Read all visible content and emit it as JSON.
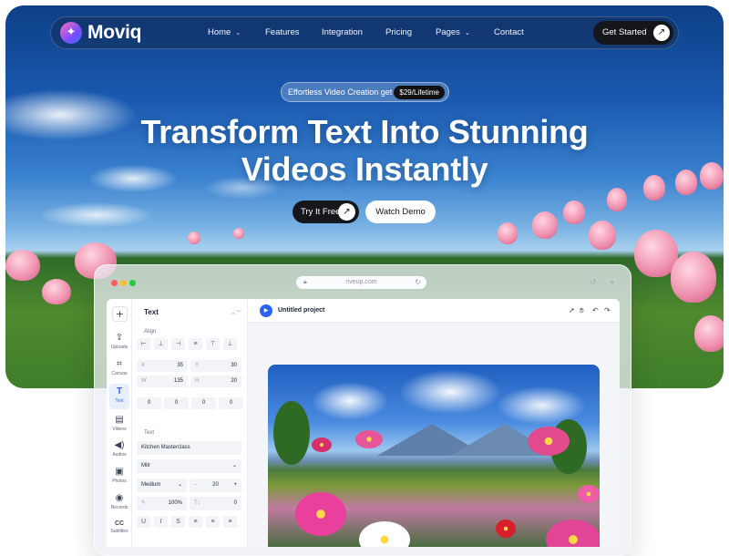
{
  "brand": {
    "name": "Moviq",
    "logo_icon": "sparkle-icon"
  },
  "nav": {
    "items": [
      {
        "label": "Home",
        "has_dropdown": true
      },
      {
        "label": "Features",
        "has_dropdown": false
      },
      {
        "label": "Integration",
        "has_dropdown": false
      },
      {
        "label": "Pricing",
        "has_dropdown": false
      },
      {
        "label": "Pages",
        "has_dropdown": true
      },
      {
        "label": "Contact",
        "has_dropdown": false
      }
    ],
    "cta": "Get Started"
  },
  "hero": {
    "badge_text": "Effortless Video Creation get it",
    "badge_price": "$29/Lifetime",
    "headline_line1": "Transform Text Into Stunning",
    "headline_line2": "Videos Instantly",
    "primary_cta": "Try It Free",
    "secondary_cta": "Watch Demo"
  },
  "browser": {
    "url": "riveup.com"
  },
  "editor": {
    "rail": [
      {
        "label": "Uploads",
        "icon": "upload-icon"
      },
      {
        "label": "Canvas",
        "icon": "crop-icon"
      },
      {
        "label": "Text",
        "icon": "text-icon",
        "active": true
      },
      {
        "label": "Videos",
        "icon": "film-icon"
      },
      {
        "label": "Audios",
        "icon": "speaker-icon"
      },
      {
        "label": "Photos",
        "icon": "image-icon"
      },
      {
        "label": "Records",
        "icon": "record-icon"
      },
      {
        "label": "Subtitles",
        "icon": "cc-icon"
      }
    ],
    "panel": {
      "title": "Text",
      "align_label": "Align",
      "x": {
        "key": "X",
        "value": "35"
      },
      "y": {
        "key": "Y",
        "value": "30"
      },
      "w": {
        "key": "W",
        "value": "135"
      },
      "h": {
        "key": "H",
        "value": "20"
      },
      "rotations": [
        "0",
        "0",
        "0",
        "0"
      ],
      "text_label": "Text",
      "text_value": "Kitchen Masterclass",
      "font": "Mitr",
      "weight": "Medium",
      "size": "20",
      "size_minus": "–",
      "size_plus": "+",
      "opacity": "100%",
      "spacing": "0"
    },
    "project_title": "Untitled project",
    "colors": {
      "accent": "#2b63f2",
      "dark": "#15161c"
    }
  }
}
